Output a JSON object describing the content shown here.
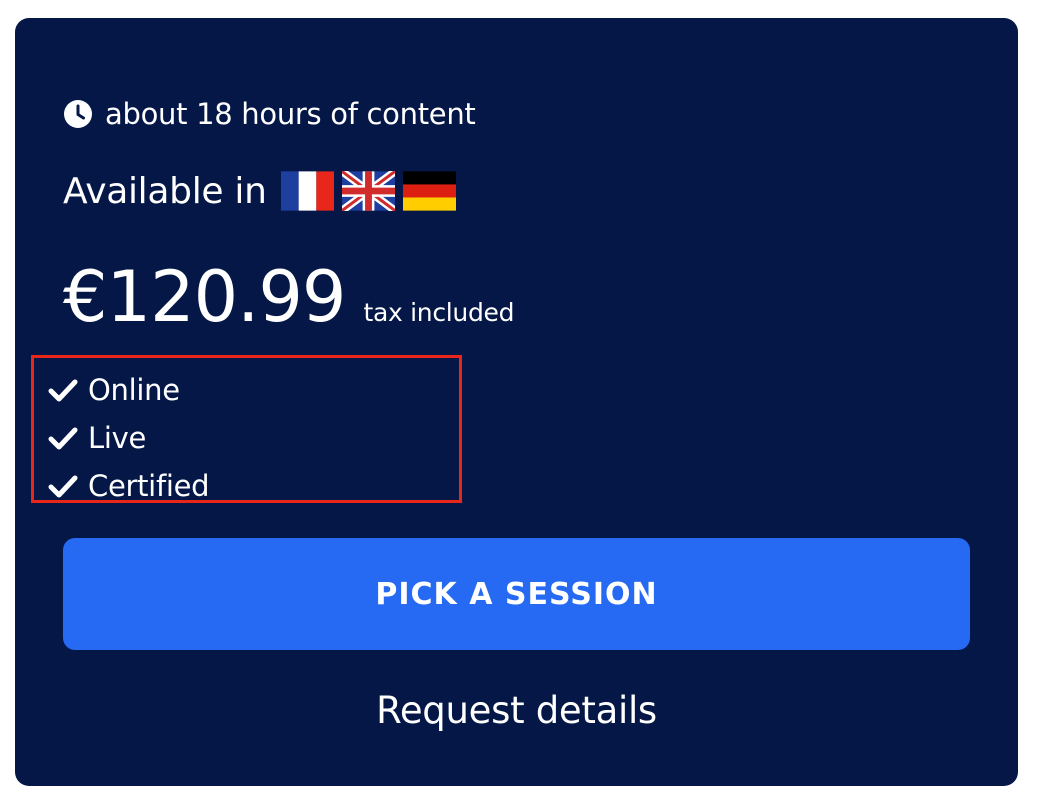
{
  "card": {
    "duration_text": "about 18 hours of content",
    "duration_icon": "clock-icon",
    "available_label": "Available in",
    "languages": [
      {
        "name": "french-flag-icon"
      },
      {
        "name": "uk-flag-icon"
      },
      {
        "name": "german-flag-icon"
      }
    ],
    "price": "€120.99",
    "tax_note": "tax included",
    "features": [
      {
        "label": "Online",
        "icon": "check-icon"
      },
      {
        "label": "Live",
        "icon": "check-icon"
      },
      {
        "label": "Certified",
        "icon": "check-icon"
      }
    ],
    "cta_label": "PICK A SESSION",
    "request_label": "Request details"
  },
  "colors": {
    "card_background": "#041746",
    "cta_background": "#2669f2",
    "highlight_border": "#e8261a",
    "text": "#ffffff"
  }
}
